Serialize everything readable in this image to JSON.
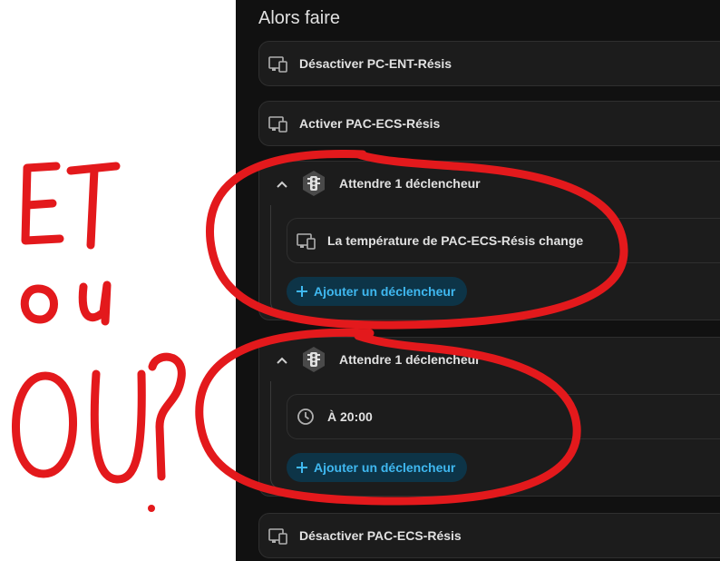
{
  "section": {
    "title": "Alors faire"
  },
  "actions": [
    {
      "label": "Désactiver PC-ENT-Résis",
      "icon": "device-icon"
    },
    {
      "label": "Activer PAC-ECS-Résis",
      "icon": "device-icon"
    }
  ],
  "waits": [
    {
      "label": "Attendre 1 déclencheur",
      "icon": "traffic-light-icon",
      "trigger": {
        "label": "La température de PAC-ECS-Résis change",
        "icon": "device-icon"
      },
      "add_label": "Ajouter un déclencheur"
    },
    {
      "label": "Attendre 1 déclencheur",
      "icon": "traffic-light-icon",
      "trigger": {
        "label": "À 20:00",
        "icon": "clock-icon"
      },
      "add_label": "Ajouter un déclencheur"
    }
  ],
  "last_action": {
    "label": "Désactiver PAC-ECS-Résis",
    "icon": "device-icon"
  },
  "annotation": {
    "text_et": "ET",
    "text_ou_small": "ou",
    "text_ou_big": "OU?",
    "color": "#e3191c"
  },
  "colors": {
    "panel_bg": "#111111",
    "card_bg": "#1c1c1c",
    "text": "#e1e1e1",
    "accent": "#3fb8f0"
  }
}
